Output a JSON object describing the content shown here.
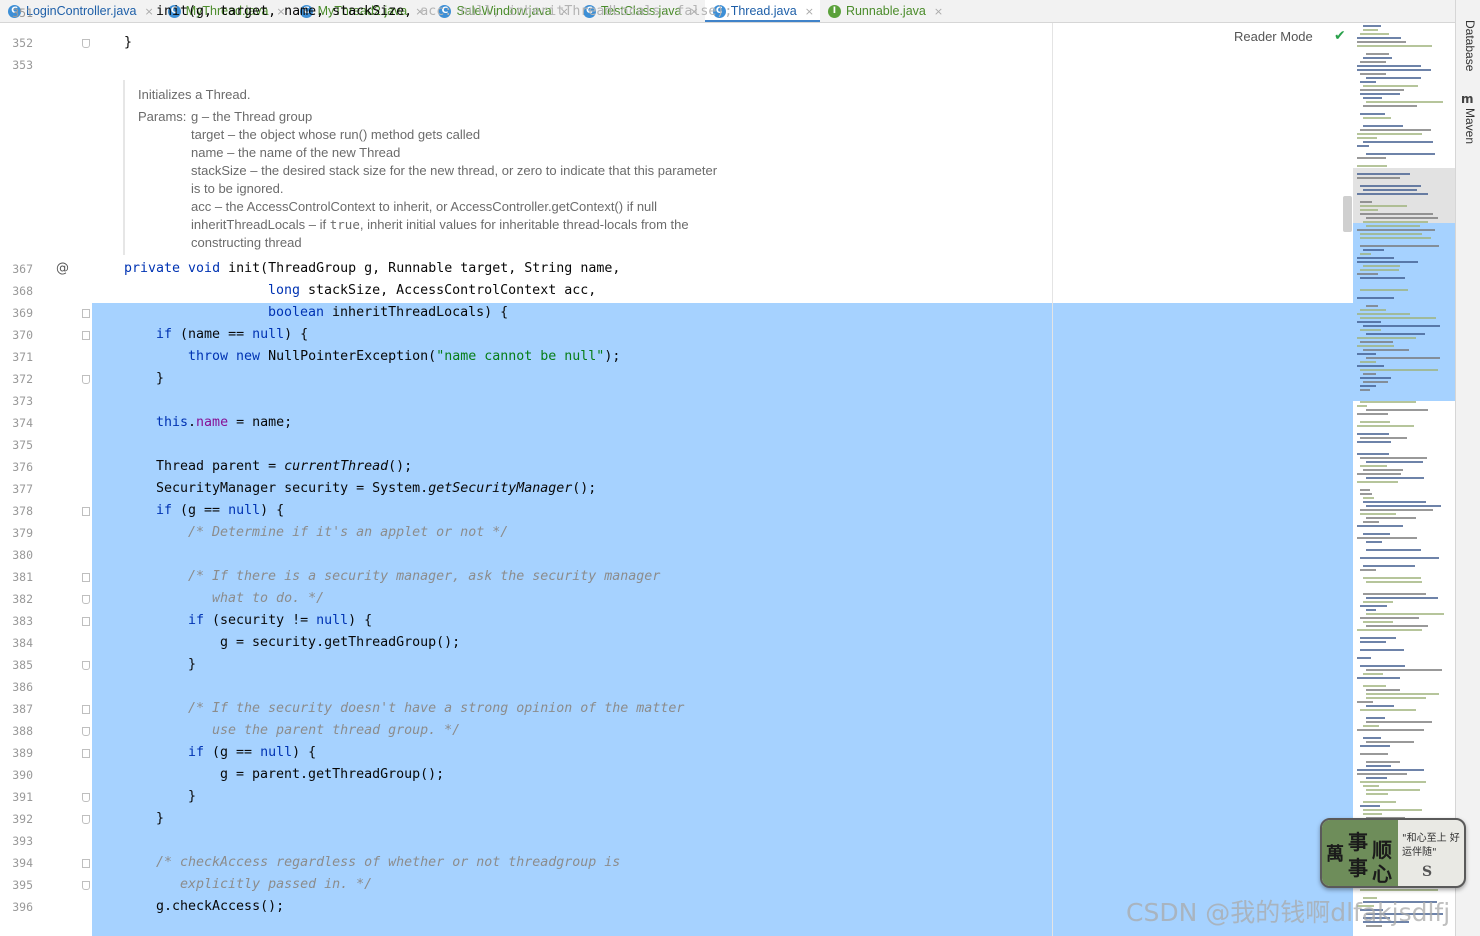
{
  "tabs": [
    {
      "label": "LoginController.java",
      "icon": "c-class-icon",
      "color": "#1e5fa8",
      "icon_letter": "C",
      "active": false
    },
    {
      "label": "MyThread.java",
      "icon": "c-class-icon",
      "color": "#4b8c2b",
      "icon_letter": "C",
      "active": false
    },
    {
      "label": "MyThread2.java",
      "icon": "c-class-icon",
      "color": "#4b8c2b",
      "icon_letter": "C",
      "active": false
    },
    {
      "label": "SaleWindow.java",
      "icon": "c-class-icon",
      "color": "#4b8c2b",
      "icon_letter": "C",
      "active": false
    },
    {
      "label": "TestClass.java",
      "icon": "c-class-icon",
      "color": "#4b8c2b",
      "icon_letter": "C",
      "active": false
    },
    {
      "label": "Thread.java",
      "icon": "c-class-icon",
      "color": "#1e5fa8",
      "icon_letter": "C",
      "active": true
    },
    {
      "label": "Runnable.java",
      "icon": "interface-icon",
      "color": "#4b8c2b",
      "icon_letter": "I",
      "active": false
    }
  ],
  "tab_close_glyph": "×",
  "toolstrip": {
    "database": "Database",
    "maven": "Maven",
    "maven_icon_letter": "m"
  },
  "reader_mode": "Reader Mode",
  "doc": {
    "summary": "Initializes a Thread.",
    "params_label": "Params:",
    "params": [
      "g – the Thread group",
      "target – the object whose run() method gets called",
      "name – the name of the new Thread",
      "stackSize – the desired stack size for the new thread, or zero to indicate that this parameter",
      "is to be ignored.",
      "acc – the AccessControlContext to inherit, or AccessController.getContext() if null",
      "inheritThreadLocals – if ",
      "constructing thread"
    ],
    "params_true": "true",
    "params_tail": ", inherit initial values for inheritable thread-locals from the"
  },
  "code_top": {
    "partial_line": "init(g, target, name, stackSize,",
    "partial_hint": "acc: null,",
    "partial_hint2": "inheritThreadLocals: false);",
    "line352": "}",
    "lnum352": "352",
    "lnum353": "353",
    "lnum351": "351"
  },
  "lines": [
    {
      "n": "367",
      "t": [
        [
          "kw",
          "private "
        ],
        [
          "kw",
          "void "
        ],
        [
          "",
          "init(ThreadGroup g, Runnable target, String name,"
        ]
      ],
      "indent": 124,
      "annot": "@"
    },
    {
      "n": "368",
      "t": [
        [
          "kw",
          "long "
        ],
        [
          "",
          "stackSize, AccessControlContext acc,"
        ]
      ],
      "indent": 268
    },
    {
      "n": "369",
      "t": [
        [
          "kw",
          "boolean "
        ],
        [
          "",
          "inheritThreadLocals) {"
        ]
      ],
      "indent": 268,
      "fold": "start"
    },
    {
      "n": "370",
      "t": [
        [
          "kw",
          "if "
        ],
        [
          "",
          "(name == "
        ],
        [
          "kw",
          "null"
        ],
        [
          "",
          ") {"
        ]
      ],
      "indent": 156,
      "fold": "start"
    },
    {
      "n": "371",
      "t": [
        [
          "kw",
          "throw new "
        ],
        [
          "",
          "NullPointerException("
        ],
        [
          "str",
          "\"name cannot be null\""
        ],
        [
          "",
          ");"
        ]
      ],
      "indent": 188
    },
    {
      "n": "372",
      "t": [
        [
          "",
          "}"
        ]
      ],
      "indent": 156,
      "fold": "end"
    },
    {
      "n": "373",
      "t": [],
      "indent": 156
    },
    {
      "n": "374",
      "t": [
        [
          "kw",
          "this"
        ],
        [
          "",
          "."
        ],
        [
          "fld",
          "name"
        ],
        [
          "",
          " = name;"
        ]
      ],
      "indent": 156
    },
    {
      "n": "375",
      "t": [],
      "indent": 156
    },
    {
      "n": "376",
      "t": [
        [
          "",
          "Thread parent = "
        ],
        [
          "mth-i",
          "currentThread"
        ],
        [
          "",
          "();"
        ]
      ],
      "indent": 156
    },
    {
      "n": "377",
      "t": [
        [
          "",
          "SecurityManager security = System."
        ],
        [
          "mth-i",
          "getSecurityManager"
        ],
        [
          "",
          "();"
        ]
      ],
      "indent": 156
    },
    {
      "n": "378",
      "t": [
        [
          "kw",
          "if "
        ],
        [
          "",
          "(g == "
        ],
        [
          "kw",
          "null"
        ],
        [
          "",
          ") {"
        ]
      ],
      "indent": 156,
      "fold": "start"
    },
    {
      "n": "379",
      "t": [
        [
          "cmt",
          "/* Determine if it's an applet or not */"
        ]
      ],
      "indent": 188
    },
    {
      "n": "380",
      "t": [],
      "indent": 188
    },
    {
      "n": "381",
      "t": [
        [
          "cmt",
          "/* If there is a security manager, ask the security manager"
        ]
      ],
      "indent": 188,
      "fold": "start"
    },
    {
      "n": "382",
      "t": [
        [
          "cmt",
          "   what to do. */"
        ]
      ],
      "indent": 188,
      "fold": "end"
    },
    {
      "n": "383",
      "t": [
        [
          "kw",
          "if "
        ],
        [
          "",
          "(security != "
        ],
        [
          "kw",
          "null"
        ],
        [
          "",
          ") {"
        ]
      ],
      "indent": 188,
      "fold": "start"
    },
    {
      "n": "384",
      "t": [
        [
          "",
          "g = security.getThreadGroup();"
        ]
      ],
      "indent": 220
    },
    {
      "n": "385",
      "t": [
        [
          "",
          "}"
        ]
      ],
      "indent": 188,
      "fold": "end"
    },
    {
      "n": "386",
      "t": [],
      "indent": 188
    },
    {
      "n": "387",
      "t": [
        [
          "cmt",
          "/* If the security doesn't have a strong opinion of the matter"
        ]
      ],
      "indent": 188,
      "fold": "start"
    },
    {
      "n": "388",
      "t": [
        [
          "cmt",
          "   use the parent thread group. */"
        ]
      ],
      "indent": 188,
      "fold": "end"
    },
    {
      "n": "389",
      "t": [
        [
          "kw",
          "if "
        ],
        [
          "",
          "(g == "
        ],
        [
          "kw",
          "null"
        ],
        [
          "",
          ") {"
        ]
      ],
      "indent": 188,
      "fold": "start"
    },
    {
      "n": "390",
      "t": [
        [
          "",
          "g = parent.getThreadGroup();"
        ]
      ],
      "indent": 220
    },
    {
      "n": "391",
      "t": [
        [
          "",
          "}"
        ]
      ],
      "indent": 188,
      "fold": "end"
    },
    {
      "n": "392",
      "t": [
        [
          "",
          "}"
        ]
      ],
      "indent": 156,
      "fold": "end"
    },
    {
      "n": "393",
      "t": [],
      "indent": 156
    },
    {
      "n": "394",
      "t": [
        [
          "cmt",
          "/* checkAccess regardless of whether or not threadgroup is"
        ]
      ],
      "indent": 156,
      "fold": "start"
    },
    {
      "n": "395",
      "t": [
        [
          "cmt",
          "   explicitly passed in. */"
        ]
      ],
      "indent": 156,
      "fold": "end"
    },
    {
      "n": "396",
      "t": [
        [
          "",
          "g.checkAccess();"
        ]
      ],
      "indent": 156
    }
  ],
  "sticker": {
    "left_big_1": "事",
    "left_big_2": "顺",
    "left_big_3": "事",
    "left_big_4": "心",
    "left_side": "萬",
    "right_text": "\"和心至上 好运伴随\"",
    "right_mark": "S"
  },
  "watermark": "CSDN @我的钱啊dlfakjsdlfj"
}
